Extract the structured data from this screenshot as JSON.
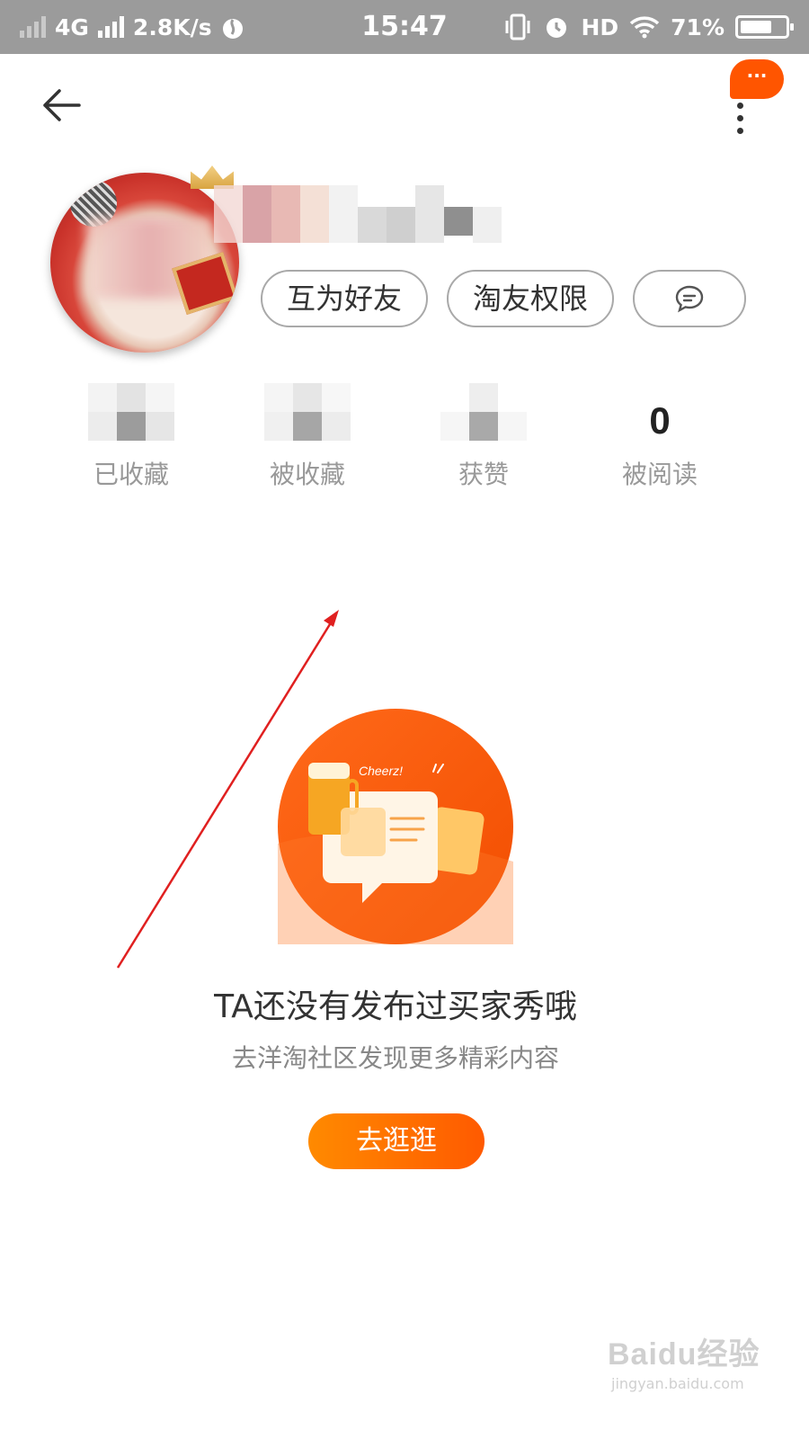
{
  "status_bar": {
    "network": "4G",
    "speed": "2.8K/s",
    "time": "15:47",
    "hd": "HD",
    "battery": "71%",
    "battery_level": 0.71
  },
  "nav": {
    "more_bubble": "···"
  },
  "profile": {
    "buttons": {
      "friend": "互为好友",
      "permission": "淘友权限"
    }
  },
  "stats": [
    {
      "label": "已收藏",
      "value": ""
    },
    {
      "label": "被收藏",
      "value": ""
    },
    {
      "label": "获赞",
      "value": ""
    },
    {
      "label": "被阅读",
      "value": "0"
    }
  ],
  "empty_state": {
    "illustration_text": "Cheerz!",
    "title": "TA还没有发布过买家秀哦",
    "subtitle": "去洋淘社区发现更多精彩内容",
    "button": "去逛逛"
  },
  "watermark": {
    "logo": "Baidu经验",
    "url": "jingyan.baidu.com"
  },
  "colors": {
    "accent": "#ff5500",
    "status_bar": "#9b9b9b",
    "annotation_arrow": "#e02020"
  }
}
